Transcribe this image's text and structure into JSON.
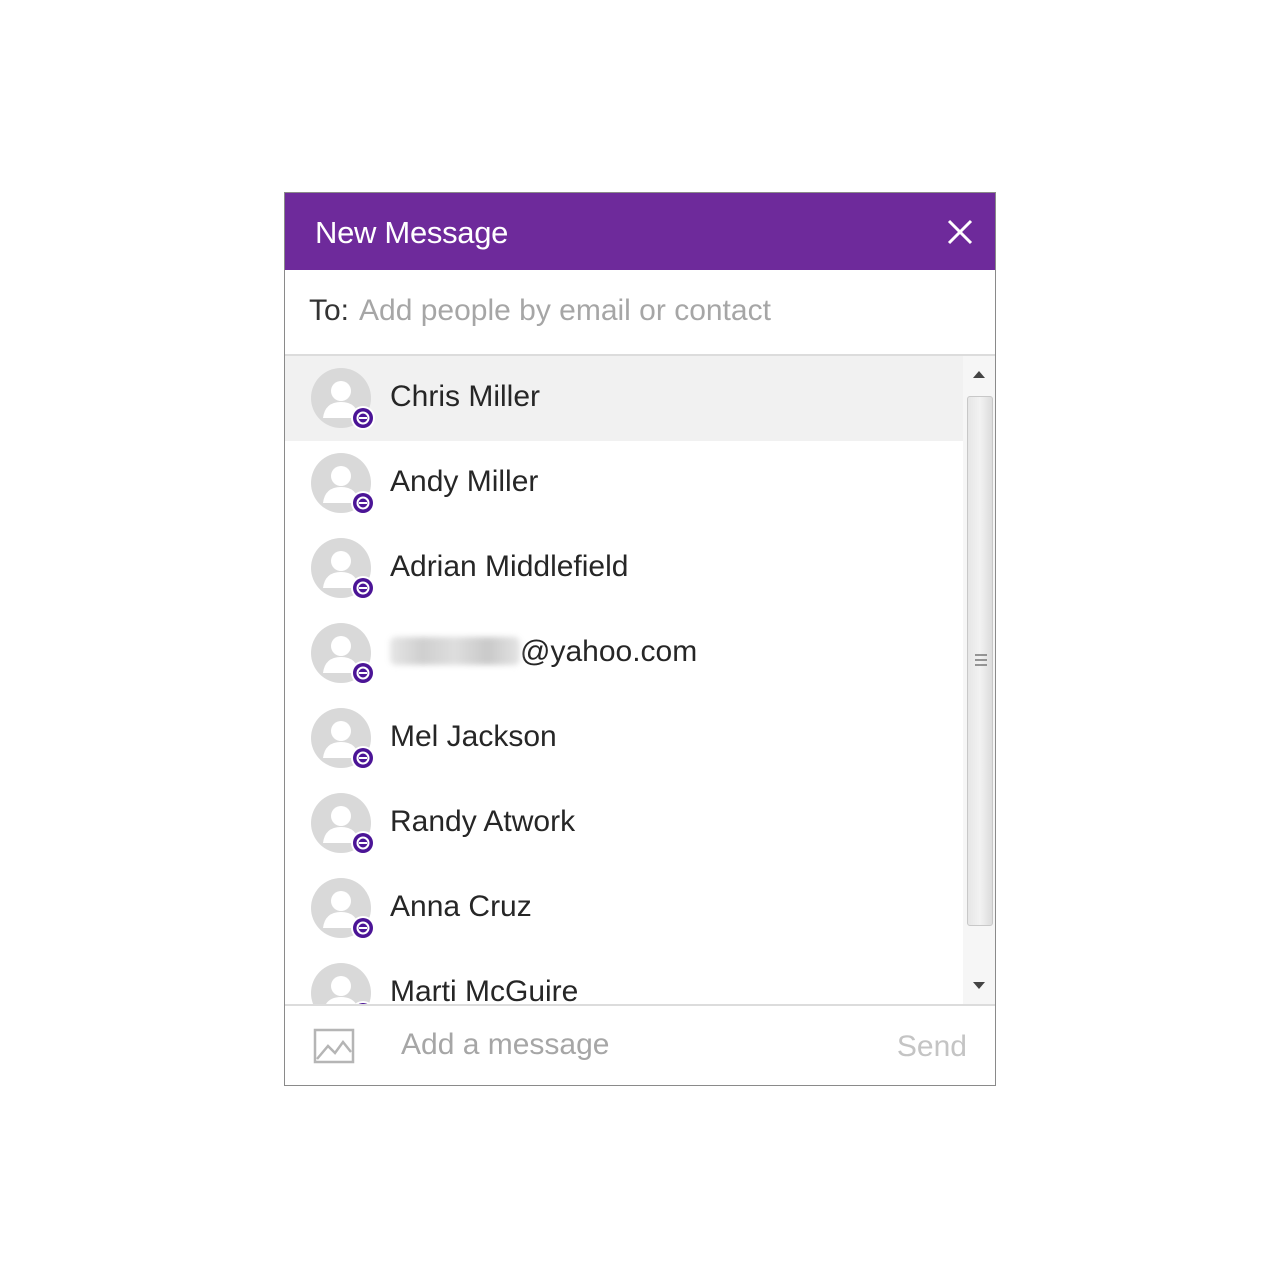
{
  "dialog": {
    "title": "New Message",
    "accent_color": "#6e2a9b"
  },
  "to": {
    "label": "To:",
    "placeholder": "Add people by email or contact"
  },
  "contacts": [
    {
      "name": "Chris Miller"
    },
    {
      "name": "Andy Miller"
    },
    {
      "name": "Adrian Middlefield"
    },
    {
      "name": "@yahoo.com"
    },
    {
      "name": "Mel Jackson"
    },
    {
      "name": "Randy Atwork"
    },
    {
      "name": "Anna Cruz"
    },
    {
      "name": "Marti McGuire"
    }
  ],
  "footer": {
    "message_placeholder": "Add a message",
    "send_label": "Send"
  },
  "icons": {
    "close": "close-icon",
    "avatar": "avatar-icon",
    "status": "status-badge-icon",
    "image": "image-icon",
    "scroll_up": "chevron-up-icon",
    "scroll_down": "chevron-down-icon"
  }
}
